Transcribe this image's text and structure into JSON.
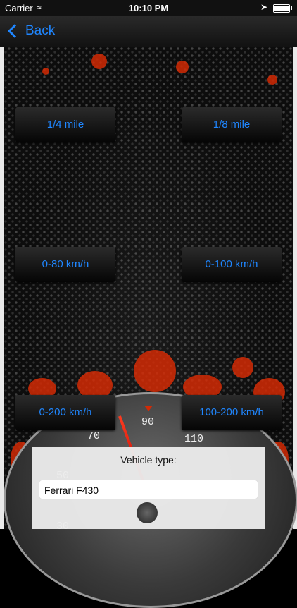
{
  "status_bar": {
    "carrier": "Carrier",
    "time": "10:10 PM"
  },
  "nav": {
    "back_label": "Back"
  },
  "buttons": {
    "quarter_mile": "1/4 mile",
    "eighth_mile": "1/8 mile",
    "zero_80": "0-80 km/h",
    "zero_100": "0-100 km/h",
    "zero_200": "0-200 km/h",
    "hundred_200": "100-200 km/h"
  },
  "gauge": {
    "labels": [
      "70",
      "90",
      "110",
      "50",
      "30"
    ]
  },
  "vehicle": {
    "label": "Vehicle type:",
    "value": "Ferrari F430"
  },
  "colors": {
    "accent": "#1f86ff",
    "splash": "#d22a05"
  },
  "icons": {
    "wifi": "wifi-icon",
    "location": "location-arrow-icon",
    "battery": "battery-icon",
    "back": "chevron-left-icon"
  }
}
